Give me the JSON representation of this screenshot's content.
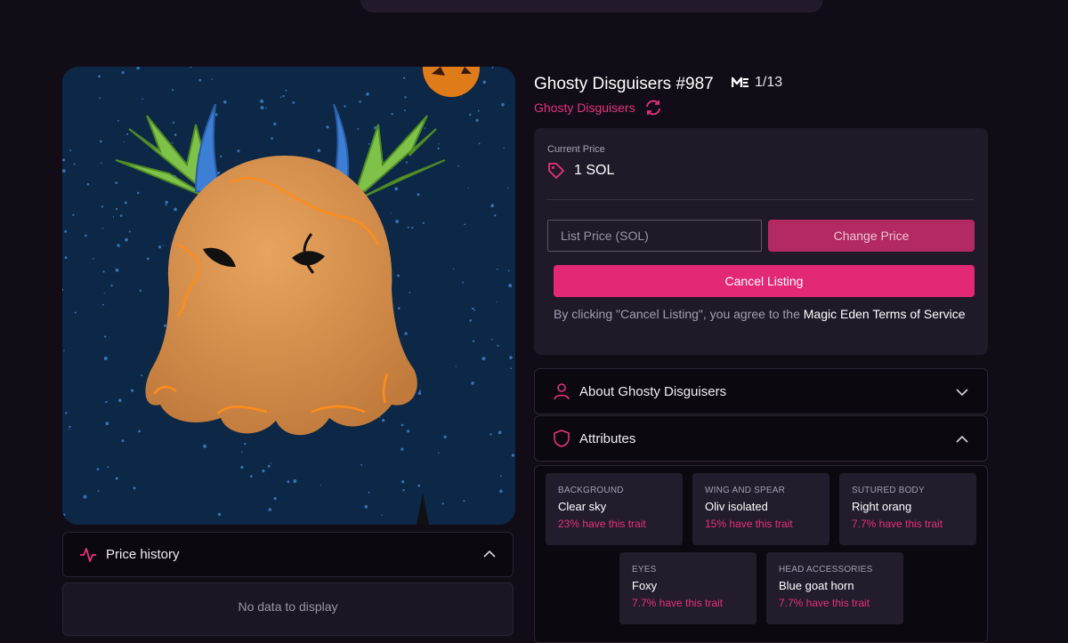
{
  "colors": {
    "accent": "#e5327a",
    "background": "#120c17",
    "card": "#1f1928"
  },
  "nft": {
    "title": "Ghosty Disguisers #987",
    "rank_icon": "magic-eden-icon",
    "rank": "1/13",
    "collection": "Ghosty Disguisers",
    "refresh_icon": "refresh-icon"
  },
  "price": {
    "label": "Current Price",
    "icon": "price-tag-icon",
    "value": "1 SOL"
  },
  "listing": {
    "input_placeholder": "List Price (SOL)",
    "change_label": "Change Price",
    "cancel_label": "Cancel Listing",
    "terms_prefix": "By clicking \"Cancel Listing\", you agree to the ",
    "terms_link": "Magic Eden Terms of Service"
  },
  "price_history": {
    "label": "Price history",
    "icon": "activity-icon",
    "empty": "No data to display"
  },
  "about": {
    "label": "About Ghosty Disguisers",
    "icon": "user-icon"
  },
  "attributes": {
    "label": "Attributes",
    "icon": "shield-icon",
    "items": [
      {
        "type": "BACKGROUND",
        "value": "Clear sky",
        "rarity": "23% have this trait"
      },
      {
        "type": "WING AND SPEAR",
        "value": "Oliv isolated",
        "rarity": "15% have this trait"
      },
      {
        "type": "SUTURED BODY",
        "value": "Right orang",
        "rarity": "7.7% have this trait"
      },
      {
        "type": "EYES",
        "value": "Foxy",
        "rarity": "7.7% have this trait"
      },
      {
        "type": "HEAD ACCESSORIES",
        "value": "Blue goat horn",
        "rarity": "7.7% have this trait"
      }
    ]
  }
}
